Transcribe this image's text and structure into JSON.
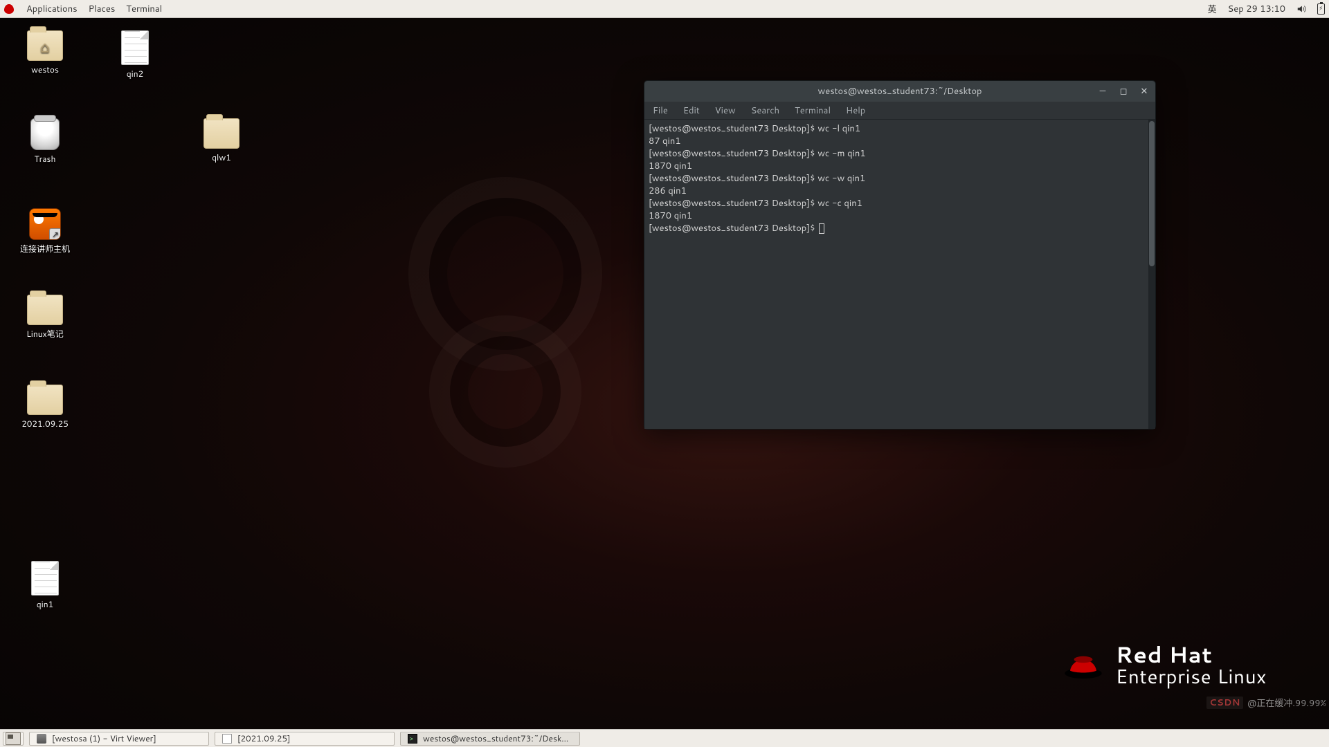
{
  "top_panel": {
    "menus": [
      "Applications",
      "Places",
      "Terminal"
    ],
    "input_method": "英",
    "datetime": "Sep 29  13:10"
  },
  "desktop_icons": {
    "westos": "westos",
    "qin2": "qin2",
    "trash": "Trash",
    "qlw1": "qlw1",
    "vnc": "连接讲师主机",
    "linux_notes": "Linux笔记",
    "date_folder": "2021.09.25",
    "qin1": "qin1"
  },
  "branding": {
    "line1": "Red Hat",
    "line2": "Enterprise Linux"
  },
  "terminal": {
    "title": "westos@westos_student73:~/Desktop",
    "menus": [
      "File",
      "Edit",
      "View",
      "Search",
      "Terminal",
      "Help"
    ],
    "prompt": "[westos@westos_student73 Desktop]$ ",
    "lines": [
      "[westos@westos_student73 Desktop]$ wc -l qin1",
      "87 qin1",
      "[westos@westos_student73 Desktop]$ wc -m qin1",
      "1870 qin1",
      "[westos@westos_student73 Desktop]$ wc -w qin1",
      "286 qin1",
      "[westos@westos_student73 Desktop]$ wc -c qin1",
      "1870 qin1"
    ]
  },
  "taskbar": {
    "virt_viewer": "[westosa (1) - Virt Viewer]",
    "doc": "[2021.09.25]",
    "terminal": "westos@westos_student73:~/Desk..."
  },
  "watermark": {
    "site": "CSDN",
    "text": "@正在缓冲.99.99%"
  }
}
